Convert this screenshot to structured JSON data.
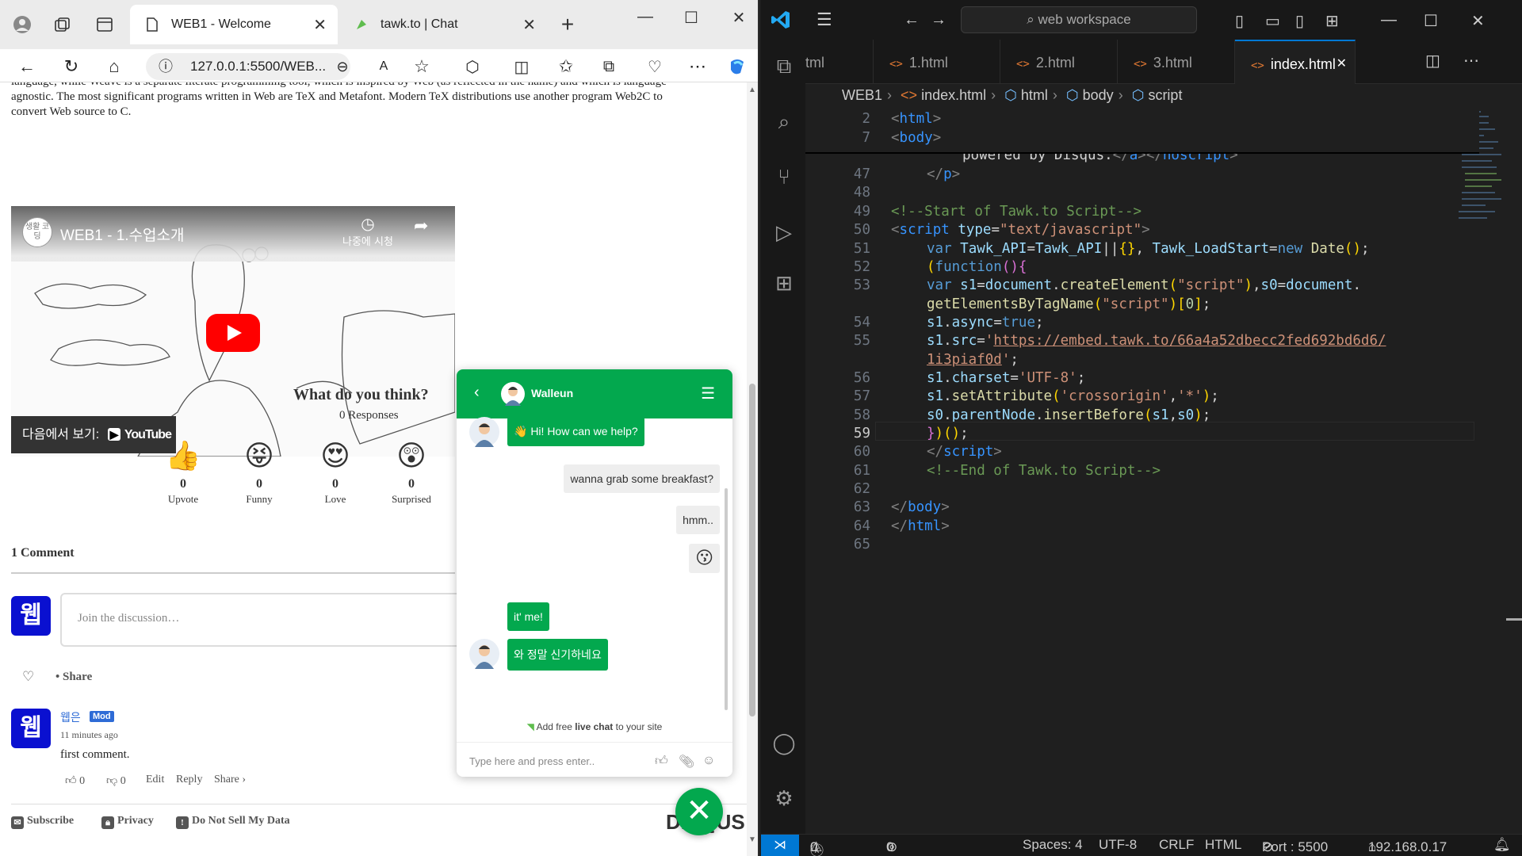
{
  "browser": {
    "tabs": [
      {
        "title": "WEB1 - Welcome",
        "active": true
      },
      {
        "title": "tawk.to | Chat",
        "active": false
      }
    ],
    "address": "127.0.0.1:5500/WEB...",
    "intro_line1": "language, while Weave is a separate literate programming tool, which is inspired by Web (as reflected in the name) and which is language-",
    "intro_line2": "agnostic. The most significant programs written in Web are TeX and Metafont. Modern TeX distributions use another program Web2C to",
    "intro_line3": "convert Web source to C.",
    "video": {
      "logo": "생활 코딩",
      "title": "WEB1 - 1.수업소개",
      "watch_on": "다음에서 보기:",
      "youtube": "YouTube",
      "later": "나중에 시청"
    },
    "disqus": {
      "question": "What do you think?",
      "responses": "0 Responses",
      "reactions": [
        {
          "icon": "👍",
          "count": "0",
          "label": "Upvote"
        },
        {
          "icon": "😝",
          "count": "0",
          "label": "Funny"
        },
        {
          "icon": "😍",
          "count": "0",
          "label": "Love"
        },
        {
          "icon": "😲",
          "count": "0",
          "label": "Surprised"
        }
      ],
      "comment_count": "1 Comment",
      "avatar_char": "웹",
      "join_placeholder": "Join the discussion…",
      "share": "• Share",
      "comment": {
        "user": "웹은",
        "badge": "Mod",
        "time": "11 minutes ago",
        "text": "first comment.",
        "up": "0",
        "down": "0",
        "edit": "Edit",
        "reply": "Reply",
        "share": "Share ›"
      },
      "footer": {
        "subscribe": "Subscribe",
        "privacy": "Privacy",
        "dnsmd": "Do Not Sell My Data",
        "brand": "DISQUS"
      }
    },
    "tawk": {
      "agent_name": "Walleun",
      "messages": [
        {
          "from": "agent",
          "text": "👋 Hi! How can we help?"
        },
        {
          "from": "visitor",
          "text": "wanna grab some breakfast?"
        },
        {
          "from": "visitor",
          "text": "hmm.."
        },
        {
          "from": "visitor",
          "text": "😗"
        },
        {
          "from": "agent",
          "text": "it' me!"
        },
        {
          "from": "agent",
          "text": "와 정말 신기하네요"
        }
      ],
      "ad_pre": "Add free ",
      "ad_bold": "live chat",
      "ad_post": " to your site",
      "input_placeholder": "Type here and press enter.."
    }
  },
  "vscode": {
    "search": "web workspace",
    "tabs": [
      "tml",
      "1.html",
      "2.html",
      "3.html",
      "index.html"
    ],
    "active_tab": "index.html",
    "breadcrumbs": [
      "WEB1",
      "index.html",
      "html",
      "body",
      "script"
    ],
    "status": {
      "errors": "0",
      "warnings": "0",
      "ports": "0",
      "spaces": "Spaces: 4",
      "encoding": "UTF-8",
      "eol": "CRLF",
      "language": "HTML",
      "port": "Port : 5500",
      "ip": "192.168.0.17"
    },
    "current_line": "59"
  }
}
